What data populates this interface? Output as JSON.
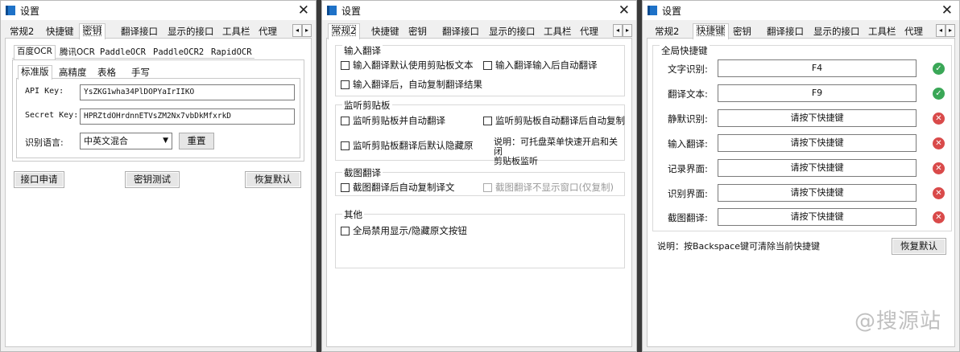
{
  "window_title": "设置",
  "close_glyph": "✕",
  "tabs": [
    "常规2",
    "快捷键",
    "密钥",
    "翻译接口",
    "显示的接口",
    "工具栏",
    "代理"
  ],
  "scroll_left": "◂",
  "scroll_right": "▸",
  "keys_window": {
    "ocr_tabs": [
      "百度OCR",
      "腾讯OCR",
      "PaddleOCR",
      "PaddleOCR2",
      "RapidOCR"
    ],
    "baidu_subtabs": [
      "标准版",
      "高精度",
      "表格",
      "手写"
    ],
    "api_key_label": "API Key:",
    "api_key_value": "YsZKG1wha34PlDOPYaIrIIKO",
    "secret_key_label": "Secret Key:",
    "secret_key_value": "HPRZtdOHrdnnETVsZM2Nx7vbDkMfxrkD",
    "lang_label": "识别语言:",
    "lang_value": "中英文混合",
    "reset_button": "重置",
    "apply_button": "接口申请",
    "test_button": "密钥测试",
    "restore_button": "恢复默认"
  },
  "general_window": {
    "group_input": "输入翻译",
    "input_opt1": "输入翻译默认使用剪贴板文本",
    "input_opt2": "输入翻译输入后自动翻译",
    "input_opt3": "输入翻译后，自动复制翻译结果",
    "group_clipboard": "监听剪贴板",
    "clip_opt1": "监听剪贴板并自动翻译",
    "clip_opt2": "监听剪贴板自动翻译后自动复制",
    "clip_opt3": "监听剪贴板翻译后默认隐藏原",
    "clip_note_line1": "说明：可托盘菜单快速开启和关闭",
    "clip_note_line2": "剪贴板监听",
    "group_screenshot": "截图翻译",
    "shot_opt1": "截图翻译后自动复制译文",
    "shot_opt2": "截图翻译不显示窗口(仅复制)",
    "group_other": "其他",
    "other_opt1": "全局禁用显示/隐藏原文按钮"
  },
  "hotkey_window": {
    "group_title": "全局快捷键",
    "rows": [
      {
        "label": "文字识别:",
        "value": "F4",
        "status": "ok"
      },
      {
        "label": "翻译文本:",
        "value": "F9",
        "status": "ok"
      },
      {
        "label": "静默识别:",
        "value": "请按下快捷键",
        "status": "error"
      },
      {
        "label": "输入翻译:",
        "value": "请按下快捷键",
        "status": "error"
      },
      {
        "label": "记录界面:",
        "value": "请按下快捷键",
        "status": "error"
      },
      {
        "label": "识别界面:",
        "value": "请按下快捷键",
        "status": "error"
      },
      {
        "label": "截图翻译:",
        "value": "请按下快捷键",
        "status": "error"
      }
    ],
    "ok_glyph": "✓",
    "err_glyph": "✕",
    "note": "说明：按Backspace键可清除当前快捷键",
    "restore_button": "恢复默认"
  },
  "watermark": "@搜源站",
  "colors": {
    "ok": "#3aa757",
    "error": "#d94a4a",
    "titlebar_icon": "#1e72c8"
  }
}
